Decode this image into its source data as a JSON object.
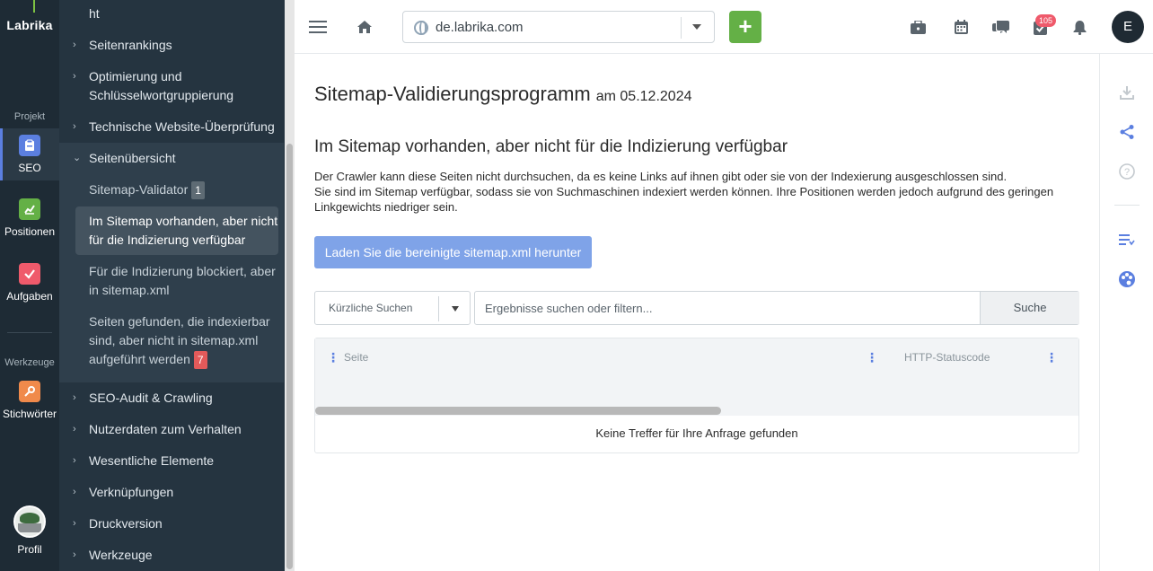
{
  "app": {
    "logo_text": "Labrika"
  },
  "rail": {
    "section_project": "Projekt",
    "section_tools": "Werkzeuge",
    "items": [
      {
        "label": "SEO",
        "icon": "clipboard-icon",
        "color": "#5b7fe0",
        "active": true
      },
      {
        "label": "Positionen",
        "icon": "chart-icon",
        "color": "#64b046"
      },
      {
        "label": "Aufgaben",
        "icon": "check-icon",
        "color": "#ef5a6b"
      },
      {
        "label": "Stichwörter",
        "icon": "key-icon",
        "color": "#f08a4b"
      },
      {
        "label": "Profil",
        "icon": "profile-avatar"
      }
    ]
  },
  "nav": {
    "top_partial": "ht",
    "items": [
      {
        "label": "Seitenrankings"
      },
      {
        "label": "Optimierung und Schlüsselwortgruppierung"
      },
      {
        "label": "Technische Website-Überprüfung"
      },
      {
        "label": "Seitenübersicht",
        "expanded": true
      },
      {
        "label": "SEO-Audit & Crawling"
      },
      {
        "label": "Nutzerdaten zum Verhalten"
      },
      {
        "label": "Wesentliche Elemente"
      },
      {
        "label": "Verknüpfungen"
      },
      {
        "label": "Druckversion"
      },
      {
        "label": "Werkzeuge"
      }
    ],
    "sub": [
      {
        "label": "Sitemap-Validator",
        "badge": "1"
      },
      {
        "label": "Im Sitemap vorhanden, aber nicht für die Indizierung verfügbar",
        "active": true
      },
      {
        "label": "Für die Indizierung blockiert, aber in sitemap.xml"
      },
      {
        "label": "Seiten gefunden, die indexierbar sind, aber nicht in sitemap.xml aufgeführt werden",
        "badge": "7"
      }
    ]
  },
  "topbar": {
    "domain": "de.labrika.com",
    "add_label": "+",
    "notification_count": "105",
    "user_initial": "E"
  },
  "main": {
    "title": "Sitemap-Validierungsprogramm",
    "date": "am 05.12.2024",
    "section_title": "Im Sitemap vorhanden, aber nicht für die Indizierung verfügbar",
    "desc_line1": "Der Crawler kann diese Seiten nicht durchsuchen, da es keine Links auf ihnen gibt oder sie von der Indexierung ausgeschlossen sind.",
    "desc_line2": "Sie sind im Sitemap verfügbar, sodass sie von Suchmaschinen indexiert werden können. Ihre Positionen werden jedoch aufgrund des geringen Linkgewichts niedriger sein.",
    "download_label": "Laden Sie die bereinigte sitemap.xml herunter",
    "recent_label": "Kürzliche Suchen",
    "search_placeholder": "Ergebnisse suchen oder filtern...",
    "search_button": "Suche",
    "table": {
      "columns": [
        "Seite",
        "HTTP-Statuscode"
      ],
      "empty_text": "Keine Treffer für Ihre Anfrage gefunden"
    }
  },
  "colors": {
    "rail_bg": "#1e2b35",
    "nav_bg": "#253440",
    "accent_blue": "#5b7fe0",
    "button_blue": "#7fa3e8",
    "green": "#64b046",
    "red_badge": "#e25a5a"
  }
}
